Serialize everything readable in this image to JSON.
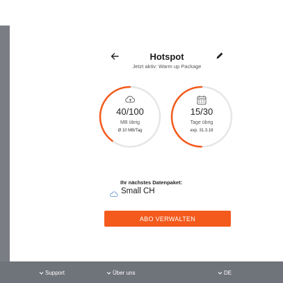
{
  "header": {
    "title": "Hotspot",
    "subtitle": "Jetzt aktiv: Warm up Package",
    "back_icon": "arrow-left-icon",
    "edit_icon": "pencil-icon"
  },
  "usage": {
    "data": {
      "icon": "cloud-sync-icon",
      "value": "40/100",
      "label": "MB übrig",
      "detail": "Ø 10 MB/Tag",
      "fraction": 0.4
    },
    "days": {
      "icon": "calendar-icon",
      "value": "15/30",
      "label": "Tage übrig",
      "detail": "exp. 31.3.18",
      "fraction": 0.5
    }
  },
  "next_package": {
    "label": "Ihr nächstes Datenpaket:",
    "icon": "cloud-sync-icon",
    "name": "Small CH"
  },
  "cta": {
    "label": "ABO VERWALTEN"
  },
  "footer": {
    "links": [
      "Support",
      "Über uns",
      "DE"
    ],
    "icon": "chevron-down-icon"
  },
  "colors": {
    "accent": "#f35a1c",
    "ring_track": "#e6e6e6",
    "footer_bg": "#6f737a",
    "page_bg": "#7a7d84"
  }
}
